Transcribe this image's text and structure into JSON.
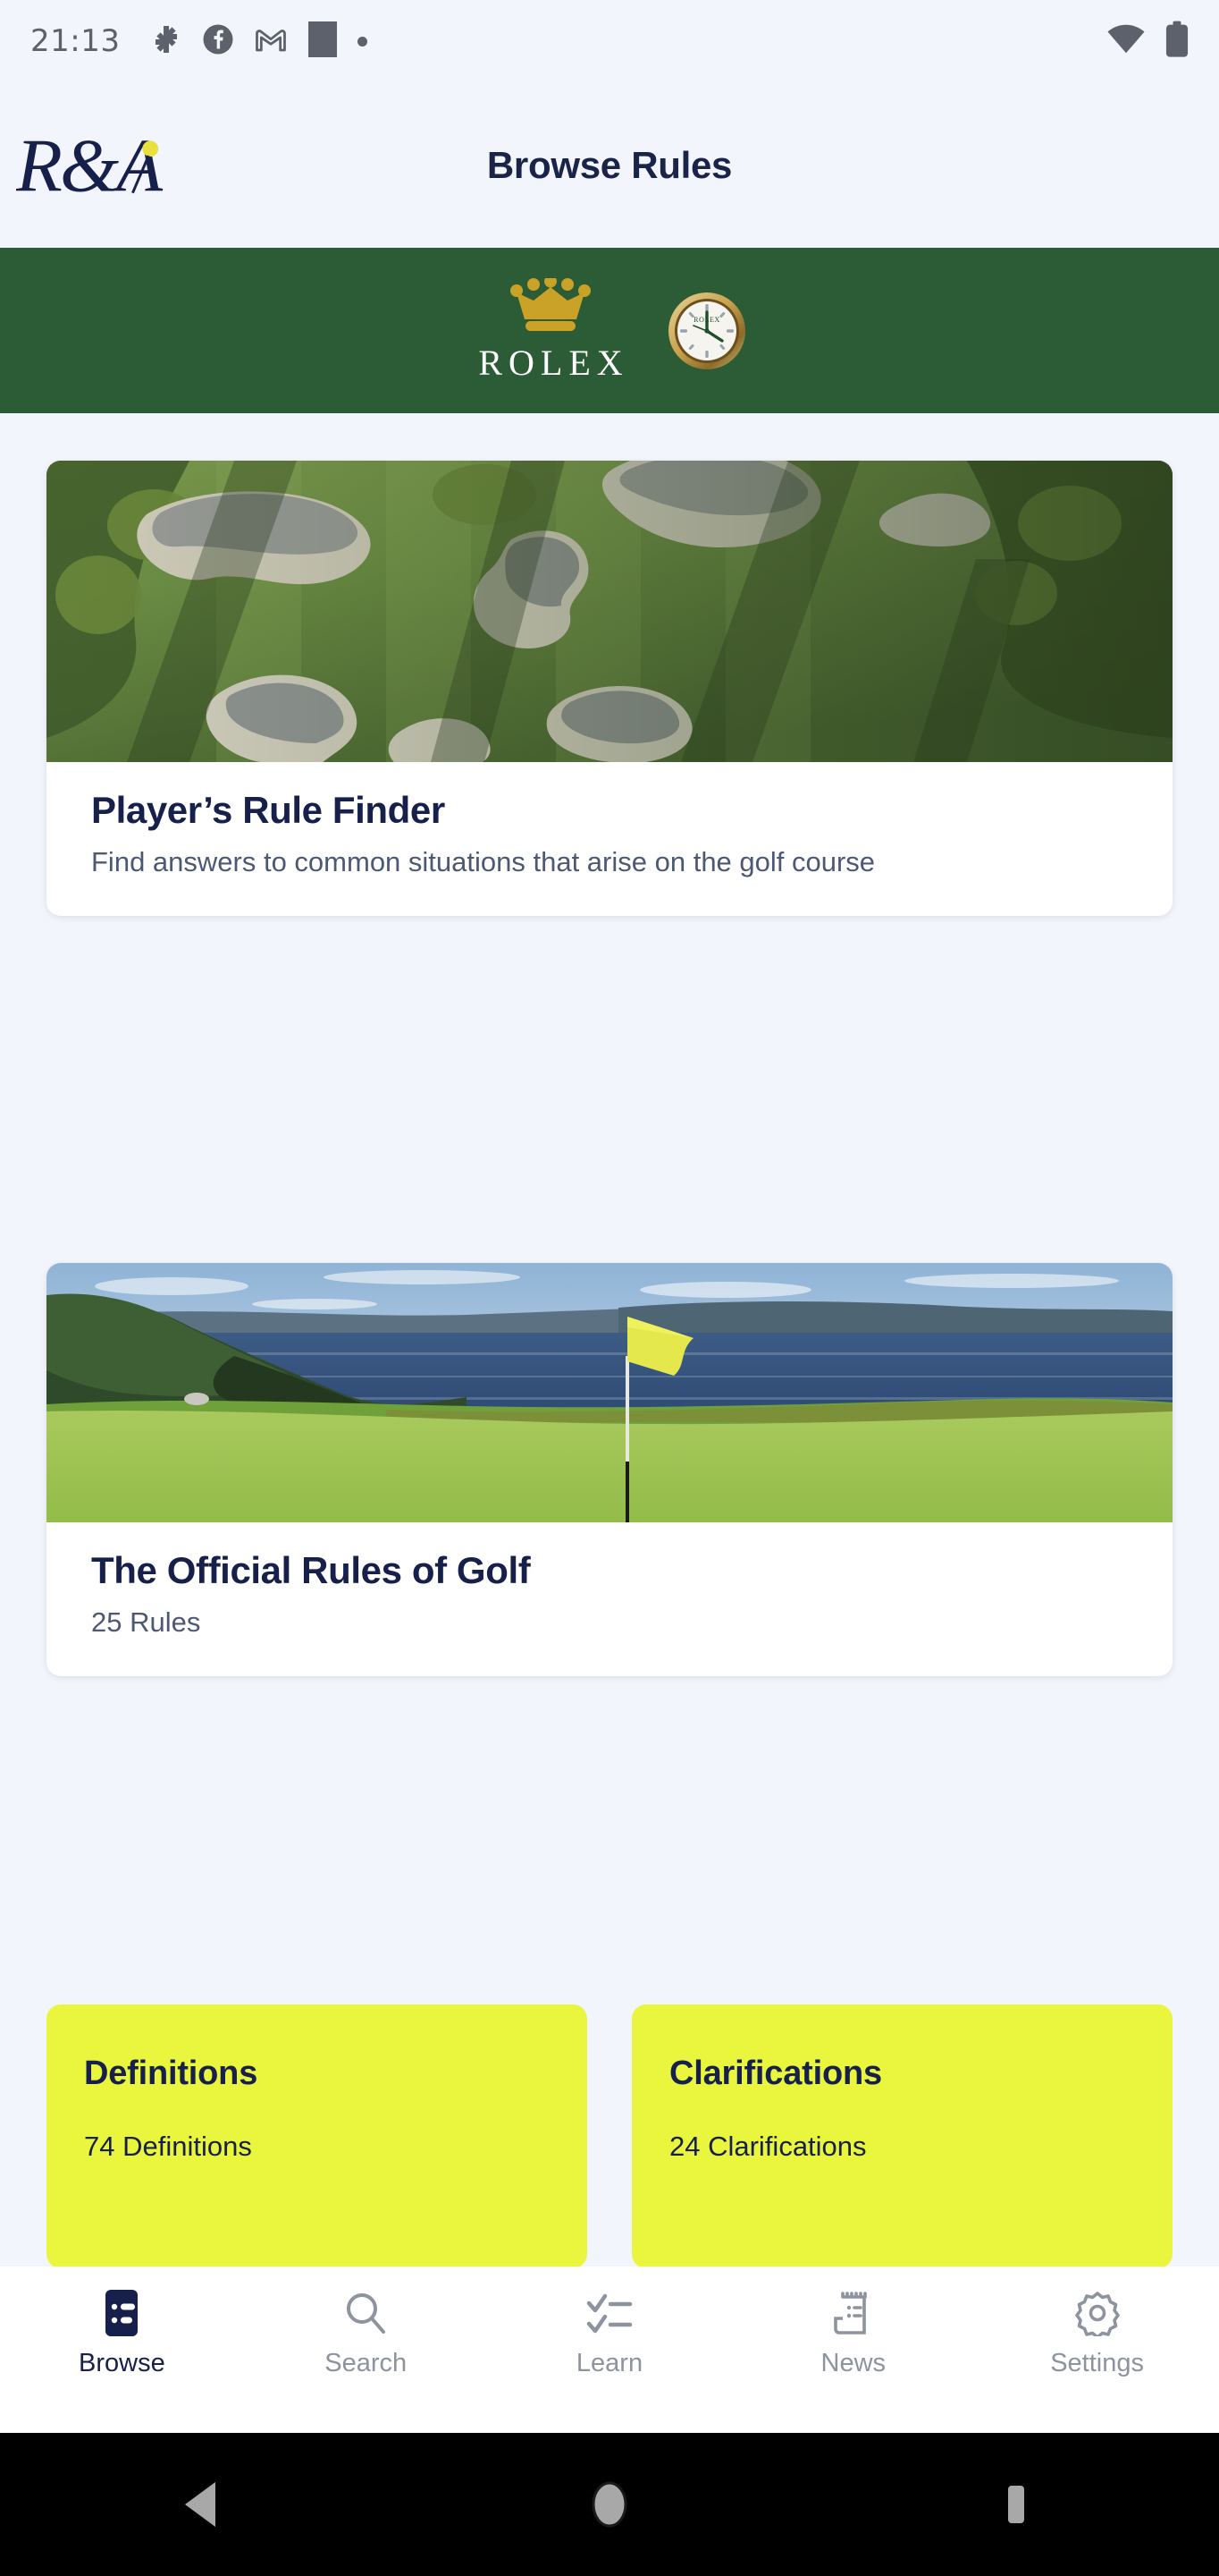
{
  "status_bar": {
    "time": "21:13",
    "left_icons": [
      "bluetooth-share-icon",
      "facebook-icon",
      "gmail-icon",
      "app-square-icon",
      "more-dot-icon"
    ],
    "right_icons": [
      "wifi-icon",
      "battery-icon"
    ],
    "icon_color": "#5c616b"
  },
  "header": {
    "logo_name": "randa-logo",
    "logo_text": "R&A",
    "title": "Browse Rules",
    "title_color": "#1a2348",
    "background": "#f2f5fb"
  },
  "sponsor_banner": {
    "brand": "ROLEX",
    "background": "#2b5c36",
    "crown_color": "#c9a227",
    "watch_label": "ROLEX",
    "icons": [
      "rolex-crown-icon",
      "rolex-watch-icon"
    ]
  },
  "cards": [
    {
      "name": "players-rule-finder",
      "image_alt": "aerial-golf-course-bunkers",
      "title": "Player’s Rule Finder",
      "subtitle": "Find answers to common situations that arise on the golf course"
    },
    {
      "name": "official-rules-of-golf",
      "image_alt": "coastal-golf-green-with-yellow-flag",
      "title": "The Official Rules of Golf",
      "subtitle": "25 Rules"
    }
  ],
  "tiles": [
    {
      "name": "definitions",
      "title": "Definitions",
      "subtitle": "74 Definitions",
      "color": "#e9f63d"
    },
    {
      "name": "clarifications",
      "title": "Clarifications",
      "subtitle": "24 Clarifications",
      "color": "#e9f63d"
    }
  ],
  "bottom_nav": {
    "active": "Browse",
    "items": [
      {
        "label": "Browse",
        "icon": "list-icon"
      },
      {
        "label": "Search",
        "icon": "search-icon"
      },
      {
        "label": "Learn",
        "icon": "checklist-icon"
      },
      {
        "label": "News",
        "icon": "newspaper-icon"
      },
      {
        "label": "Settings",
        "icon": "gear-icon"
      }
    ],
    "active_color": "#16204a",
    "inactive_color": "#8d939f"
  },
  "android_nav": {
    "buttons": [
      "back-button",
      "home-button",
      "recents-button"
    ],
    "background": "#000000"
  }
}
